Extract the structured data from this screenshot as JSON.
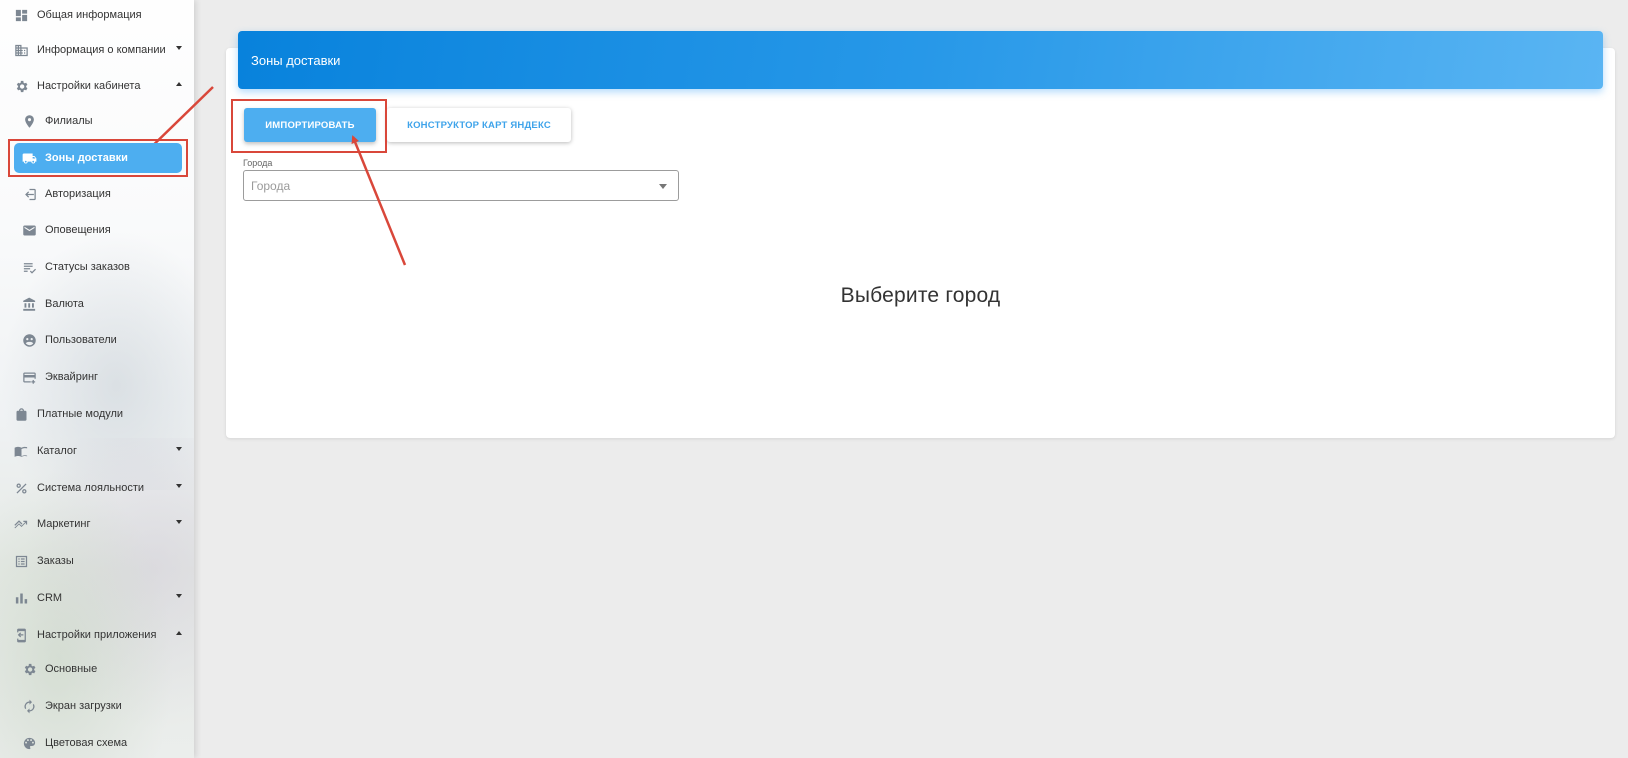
{
  "sidebar": {
    "items": [
      {
        "label": "Общая информация",
        "icon": "dashboard-icon"
      },
      {
        "label": "Информация о компании",
        "icon": "building-icon",
        "chevron": "down"
      },
      {
        "label": "Настройки кабинета",
        "icon": "gear-icon",
        "chevron": "up"
      },
      {
        "label": "Филиалы",
        "icon": "location-pin-icon"
      },
      {
        "label": "Зоны доставки",
        "icon": "truck-icon",
        "active": true
      },
      {
        "label": "Авторизация",
        "icon": "login-icon"
      },
      {
        "label": "Оповещения",
        "icon": "mail-icon"
      },
      {
        "label": "Статусы заказов",
        "icon": "list-check-icon"
      },
      {
        "label": "Валюта",
        "icon": "bank-icon"
      },
      {
        "label": "Пользователи",
        "icon": "users-icon"
      },
      {
        "label": "Эквайринг",
        "icon": "card-icon"
      },
      {
        "label": "Платные модули",
        "icon": "shopping-bag-icon"
      },
      {
        "label": "Каталог",
        "icon": "book-icon",
        "chevron": "down"
      },
      {
        "label": "Система лояльности",
        "icon": "percent-icon",
        "chevron": "down"
      },
      {
        "label": "Маркетинг",
        "icon": "trending-icon",
        "chevron": "down"
      },
      {
        "label": "Заказы",
        "icon": "list-icon"
      },
      {
        "label": "CRM",
        "icon": "bar-chart-icon",
        "chevron": "down"
      },
      {
        "label": "Настройки приложения",
        "icon": "phone-settings-icon",
        "chevron": "up"
      },
      {
        "label": "Основные",
        "icon": "gear-icon"
      },
      {
        "label": "Экран загрузки",
        "icon": "refresh-icon"
      },
      {
        "label": "Цветовая схема",
        "icon": "palette-icon"
      }
    ]
  },
  "main": {
    "header_title": "Зоны доставки",
    "import_button": "ИМПОРТИРОВАТЬ",
    "yandex_button": "КОНСТРУКТОР КАРТ ЯНДЕКС",
    "city_field_label": "Города",
    "city_field_placeholder": "Города",
    "empty_message": "Выберите город"
  },
  "colors": {
    "accent": "#4daef0",
    "header_gradient_start": "#0882dc",
    "header_gradient_end": "#5ab5f3",
    "annotation_red": "#d9473a"
  }
}
